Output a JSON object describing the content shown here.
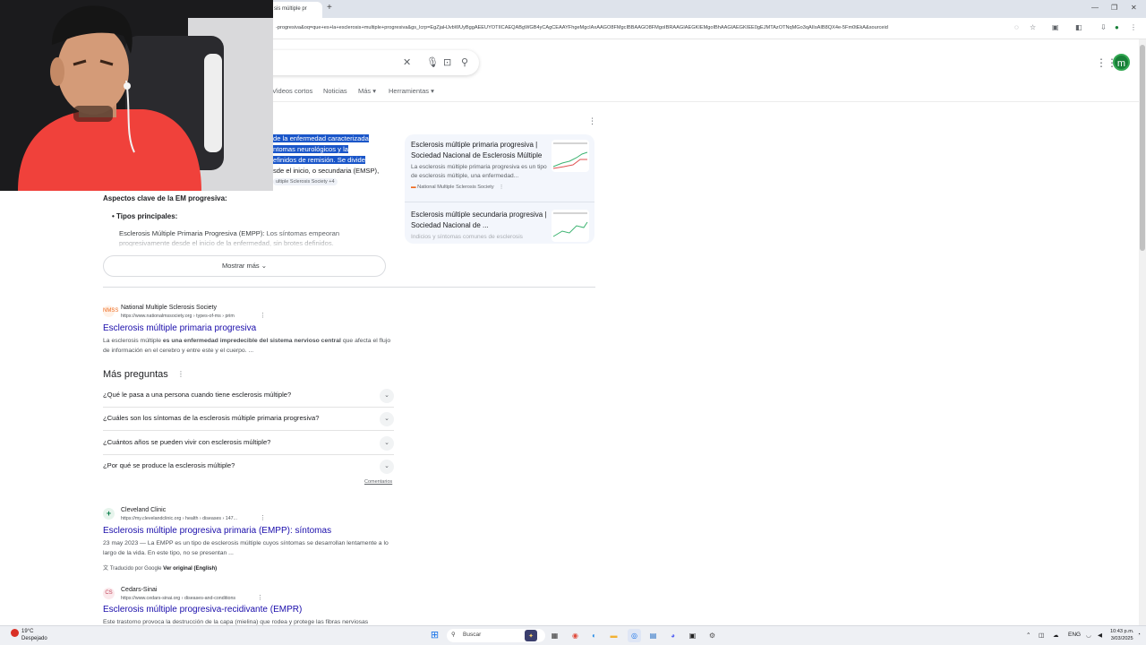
{
  "browser": {
    "tab_title": "sis múltiple pr",
    "new_tab": "+",
    "url": "-progresiva&oq=que+es+la+esclerosis+multiple+progresiva&gs_lcrp=EgZjaHJvbWUyBggAEEUYOTIICAEQABgWGB4yCAgCEAAYFhgeMgcIAxAAGO8FMgcIBBAAGO8FMgoIBRAAGIAEGKIEMgoIBhAAGIAEGKIEE0gEJMTAzOTNqMGo3qAIIsAIB8QX4e-5Fm0tEkA&sourceid",
    "window_controls": [
      "—",
      "❐",
      "✕"
    ]
  },
  "search": {
    "clear_icon": "✕",
    "filters": [
      "Videos cortos",
      "Noticias",
      "Más",
      "Herramientas"
    ],
    "avatar_letter": "m"
  },
  "overview": {
    "lines": [
      "de la enfermedad caracterizada",
      "ntomas neurológicos y la",
      "efinidos de remisión.",
      " Se divide",
      "sde el inicio, o secundaria (EMSP),"
    ],
    "chip": "ultiple Sclerosis Society +4",
    "key_title": "Aspectos clave de la EM progresiva:",
    "bullet": "Tipos principales:",
    "subitem_bold": "Esclerosis Múltiple Primaria Progresiva (EMPP):",
    "subitem_rest": " Los síntomas empeoran progresivamente desde el inicio de la enfermedad, sin brotes definidos.",
    "show_more": "Mostrar más",
    "sources": [
      {
        "title": "Esclerosis múltiple primaria progresiva | Sociedad Nacional de Esclerosis Múltiple",
        "snippet": "La esclerosis múltiple primaria progresiva es un tipo de esclerosis múltiple, una enfermedad...",
        "site": "National Multiple Sclerosis Society"
      },
      {
        "title": "Esclerosis múltiple secundaria progresiva | Sociedad Nacional de ...",
        "snippet": "Indicios y síntomas comunes de esclerosis",
        "site": ""
      }
    ]
  },
  "results": [
    {
      "site": "National Multiple Sclerosis Society",
      "url": "https://www.nationalmssociety.org › types-of-ms › prim",
      "title": "Esclerosis múltiple primaria progresiva",
      "snippet_pre": "La esclerosis múltiple ",
      "snippet_bold": "es una enfermedad impredecible del sistema nervioso central",
      "snippet_post": " que afecta el flujo de información en el cerebro y entre este y el cuerpo. ...",
      "favicon": "NMSS",
      "favicon_color": "#ee6a1f"
    },
    {
      "site": "Cleveland Clinic",
      "url": "https://my.clevelandclinic.org › health › diseases › 147...",
      "title": "Esclerosis múltiple progresiva primaria (EMPP): síntomas",
      "snippet": "23 may 2023 — La EMPP es un tipo de esclerosis múltiple cuyos síntomas se desarrollan lentamente a lo largo de la vida. En este tipo, no se presentan ...",
      "translated": "Traducido por Google",
      "original": "Ver original (English)",
      "favicon": "+",
      "favicon_color": "#0a7d4a"
    },
    {
      "site": "Cedars-Sinai",
      "url": "https://www.cedars-sinai.org › diseases-and-conditions",
      "title": "Esclerosis múltiple progresiva-recidivante (EMPR)",
      "snippet": "Este trastorno provoca la destrucción de la capa (mielina) que rodea y protege las fibras nerviosas",
      "favicon": "CS",
      "favicon_color": "#c0445a"
    }
  ],
  "paa": {
    "title": "Más preguntas",
    "questions": [
      "¿Qué le pasa a una persona cuando tiene esclerosis múltiple?",
      "¿Cuáles son los síntomas de la esclerosis múltiple primaria progresiva?",
      "¿Cuántos años se pueden vivir con esclerosis múltiple?",
      "¿Por qué se produce la esclerosis múltiple?"
    ],
    "comments": "Comentarios"
  },
  "taskbar": {
    "temperature": "19°C",
    "weather": "Despejado",
    "search_label": "Buscar",
    "lang": "ENG",
    "time": "10:43 p.m.",
    "date": "3/03/2025"
  },
  "colors": {
    "link": "#1a0dab",
    "highlight": "#1a56c9",
    "accent_green": "#188038"
  }
}
